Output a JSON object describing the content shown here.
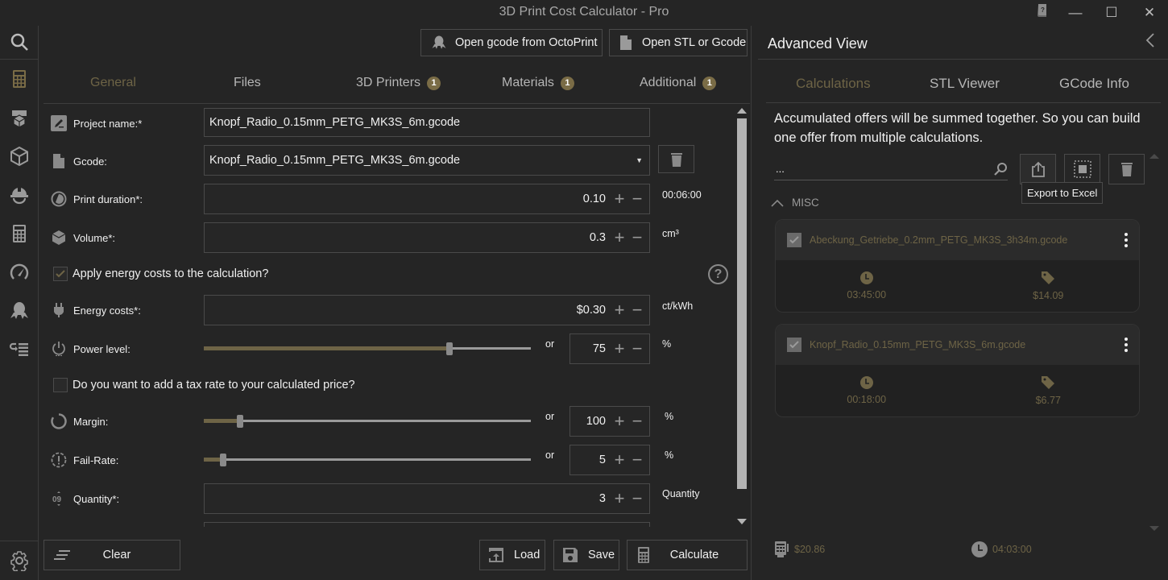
{
  "window": {
    "title": "3D Print Cost Calculator - Pro",
    "help_icon": "help-book-icon",
    "minimize": "—",
    "maximize": "☐",
    "close": "✕"
  },
  "sidebar": {
    "items": [
      {
        "name": "search",
        "icon": "search-icon"
      },
      {
        "name": "calculator",
        "icon": "calculator-icon",
        "active": true
      },
      {
        "name": "printers",
        "icon": "printer-icon"
      },
      {
        "name": "materials",
        "icon": "cube-icon"
      },
      {
        "name": "workers",
        "icon": "hard-hat-icon"
      },
      {
        "name": "calculations",
        "icon": "calculator-icon"
      },
      {
        "name": "performance",
        "icon": "speedometer-icon"
      },
      {
        "name": "octoprint",
        "icon": "octopus-icon"
      },
      {
        "name": "list",
        "icon": "list-icon"
      },
      {
        "name": "settings",
        "icon": "gear-icon"
      }
    ]
  },
  "toolbar": {
    "octoprint_label": "Open gcode from OctoPrint",
    "open_file_label": "Open STL or Gcode"
  },
  "tabs": [
    {
      "label": "General",
      "active": true
    },
    {
      "label": "Files"
    },
    {
      "label": "3D Printers",
      "badge": "1"
    },
    {
      "label": "Materials",
      "badge": "1"
    },
    {
      "label": "Additional",
      "badge": "1"
    }
  ],
  "form": {
    "project_name": {
      "label": "Project name:*",
      "value": "Knopf_Radio_0.15mm_PETG_MK3S_6m.gcode"
    },
    "gcode": {
      "label": "Gcode:",
      "value": "Knopf_Radio_0.15mm_PETG_MK3S_6m.gcode"
    },
    "print_duration": {
      "label": "Print duration*:",
      "value": "0.10",
      "unit": "00:06:00"
    },
    "volume": {
      "label": "Volume*:",
      "value": "0.3",
      "unit": "cm³"
    },
    "apply_energy": {
      "label": "Apply energy costs to the calculation?",
      "checked": true
    },
    "energy_costs": {
      "label": "Energy costs*:",
      "value": "$0.30",
      "unit": "ct/kWh"
    },
    "power_level": {
      "label": "Power level:",
      "value": "75",
      "unit": "%",
      "or": "or",
      "slider_fraction": 0.75
    },
    "tax_rate": {
      "label": "Do you want to add a tax rate to your calculated price?",
      "checked": false
    },
    "margin": {
      "label": "Margin:",
      "value": "100",
      "unit": "%",
      "or": "or",
      "slider_fraction": 0.11
    },
    "fail_rate": {
      "label": "Fail-Rate:",
      "value": "5",
      "unit": "%",
      "or": "or",
      "slider_fraction": 0.06
    },
    "quantity": {
      "label": "Quantity*:",
      "value": "3",
      "unit": "Quantity"
    },
    "plus": "+",
    "minus": "−"
  },
  "bottom_bar": {
    "clear_label": "Clear",
    "load_label": "Load",
    "save_label": "Save",
    "calculate_label": "Calculate"
  },
  "advanced": {
    "title": "Advanced View",
    "tabs": [
      {
        "label": "Calculations",
        "active": true
      },
      {
        "label": "STL Viewer"
      },
      {
        "label": "GCode Info"
      }
    ],
    "info_text": "Accumulated offers will be summed together. So you can build one offer from multiple calculations.",
    "search_placeholder": "...",
    "tooltip": "Export to Excel",
    "group_label": "MISC",
    "calculations": [
      {
        "name": "Abeckung_Getriebe_0.2mm_PETG_MK3S_3h34m.gcode",
        "duration": "03:45:00",
        "price": "$14.09",
        "checked": true
      },
      {
        "name": "Knopf_Radio_0.15mm_PETG_MK3S_6m.gcode",
        "duration": "00:18:00",
        "price": "$6.77",
        "checked": true
      }
    ],
    "totals": {
      "price": "$20.86",
      "duration": "04:03:00"
    }
  },
  "colors": {
    "accent": "#6e6446",
    "badge": "#7a6c46",
    "background": "#252525"
  }
}
